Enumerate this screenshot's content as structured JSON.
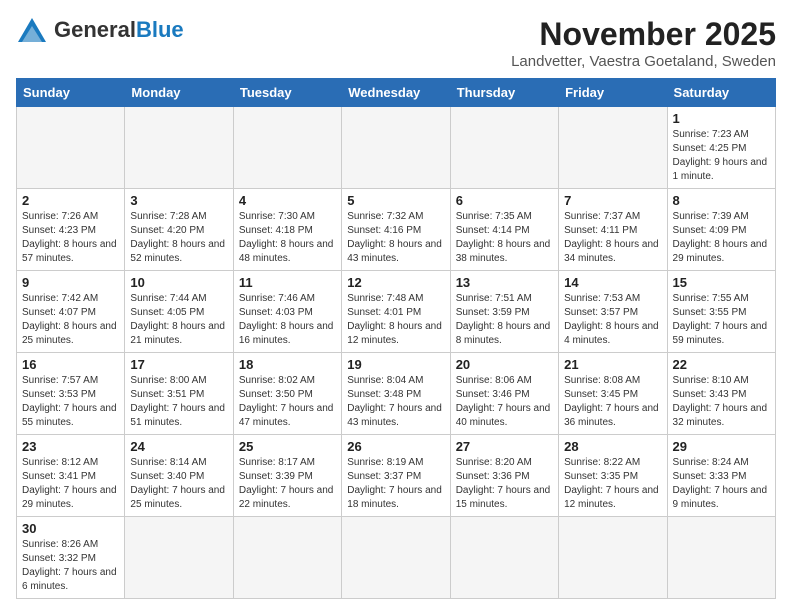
{
  "header": {
    "logo_general": "General",
    "logo_blue": "Blue",
    "month_year": "November 2025",
    "location": "Landvetter, Vaestra Goetaland, Sweden"
  },
  "weekdays": [
    "Sunday",
    "Monday",
    "Tuesday",
    "Wednesday",
    "Thursday",
    "Friday",
    "Saturday"
  ],
  "days": [
    {
      "num": "",
      "info": ""
    },
    {
      "num": "",
      "info": ""
    },
    {
      "num": "",
      "info": ""
    },
    {
      "num": "",
      "info": ""
    },
    {
      "num": "",
      "info": ""
    },
    {
      "num": "",
      "info": ""
    },
    {
      "num": "1",
      "info": "Sunrise: 7:23 AM\nSunset: 4:25 PM\nDaylight: 9 hours\nand 1 minute."
    },
    {
      "num": "2",
      "info": "Sunrise: 7:26 AM\nSunset: 4:23 PM\nDaylight: 8 hours\nand 57 minutes."
    },
    {
      "num": "3",
      "info": "Sunrise: 7:28 AM\nSunset: 4:20 PM\nDaylight: 8 hours\nand 52 minutes."
    },
    {
      "num": "4",
      "info": "Sunrise: 7:30 AM\nSunset: 4:18 PM\nDaylight: 8 hours\nand 48 minutes."
    },
    {
      "num": "5",
      "info": "Sunrise: 7:32 AM\nSunset: 4:16 PM\nDaylight: 8 hours\nand 43 minutes."
    },
    {
      "num": "6",
      "info": "Sunrise: 7:35 AM\nSunset: 4:14 PM\nDaylight: 8 hours\nand 38 minutes."
    },
    {
      "num": "7",
      "info": "Sunrise: 7:37 AM\nSunset: 4:11 PM\nDaylight: 8 hours\nand 34 minutes."
    },
    {
      "num": "8",
      "info": "Sunrise: 7:39 AM\nSunset: 4:09 PM\nDaylight: 8 hours\nand 29 minutes."
    },
    {
      "num": "9",
      "info": "Sunrise: 7:42 AM\nSunset: 4:07 PM\nDaylight: 8 hours\nand 25 minutes."
    },
    {
      "num": "10",
      "info": "Sunrise: 7:44 AM\nSunset: 4:05 PM\nDaylight: 8 hours\nand 21 minutes."
    },
    {
      "num": "11",
      "info": "Sunrise: 7:46 AM\nSunset: 4:03 PM\nDaylight: 8 hours\nand 16 minutes."
    },
    {
      "num": "12",
      "info": "Sunrise: 7:48 AM\nSunset: 4:01 PM\nDaylight: 8 hours\nand 12 minutes."
    },
    {
      "num": "13",
      "info": "Sunrise: 7:51 AM\nSunset: 3:59 PM\nDaylight: 8 hours\nand 8 minutes."
    },
    {
      "num": "14",
      "info": "Sunrise: 7:53 AM\nSunset: 3:57 PM\nDaylight: 8 hours\nand 4 minutes."
    },
    {
      "num": "15",
      "info": "Sunrise: 7:55 AM\nSunset: 3:55 PM\nDaylight: 7 hours\nand 59 minutes."
    },
    {
      "num": "16",
      "info": "Sunrise: 7:57 AM\nSunset: 3:53 PM\nDaylight: 7 hours\nand 55 minutes."
    },
    {
      "num": "17",
      "info": "Sunrise: 8:00 AM\nSunset: 3:51 PM\nDaylight: 7 hours\nand 51 minutes."
    },
    {
      "num": "18",
      "info": "Sunrise: 8:02 AM\nSunset: 3:50 PM\nDaylight: 7 hours\nand 47 minutes."
    },
    {
      "num": "19",
      "info": "Sunrise: 8:04 AM\nSunset: 3:48 PM\nDaylight: 7 hours\nand 43 minutes."
    },
    {
      "num": "20",
      "info": "Sunrise: 8:06 AM\nSunset: 3:46 PM\nDaylight: 7 hours\nand 40 minutes."
    },
    {
      "num": "21",
      "info": "Sunrise: 8:08 AM\nSunset: 3:45 PM\nDaylight: 7 hours\nand 36 minutes."
    },
    {
      "num": "22",
      "info": "Sunrise: 8:10 AM\nSunset: 3:43 PM\nDaylight: 7 hours\nand 32 minutes."
    },
    {
      "num": "23",
      "info": "Sunrise: 8:12 AM\nSunset: 3:41 PM\nDaylight: 7 hours\nand 29 minutes."
    },
    {
      "num": "24",
      "info": "Sunrise: 8:14 AM\nSunset: 3:40 PM\nDaylight: 7 hours\nand 25 minutes."
    },
    {
      "num": "25",
      "info": "Sunrise: 8:17 AM\nSunset: 3:39 PM\nDaylight: 7 hours\nand 22 minutes."
    },
    {
      "num": "26",
      "info": "Sunrise: 8:19 AM\nSunset: 3:37 PM\nDaylight: 7 hours\nand 18 minutes."
    },
    {
      "num": "27",
      "info": "Sunrise: 8:20 AM\nSunset: 3:36 PM\nDaylight: 7 hours\nand 15 minutes."
    },
    {
      "num": "28",
      "info": "Sunrise: 8:22 AM\nSunset: 3:35 PM\nDaylight: 7 hours\nand 12 minutes."
    },
    {
      "num": "29",
      "info": "Sunrise: 8:24 AM\nSunset: 3:33 PM\nDaylight: 7 hours\nand 9 minutes."
    },
    {
      "num": "30",
      "info": "Sunrise: 8:26 AM\nSunset: 3:32 PM\nDaylight: 7 hours\nand 6 minutes."
    },
    {
      "num": "",
      "info": ""
    },
    {
      "num": "",
      "info": ""
    },
    {
      "num": "",
      "info": ""
    },
    {
      "num": "",
      "info": ""
    },
    {
      "num": "",
      "info": ""
    },
    {
      "num": "",
      "info": ""
    }
  ]
}
